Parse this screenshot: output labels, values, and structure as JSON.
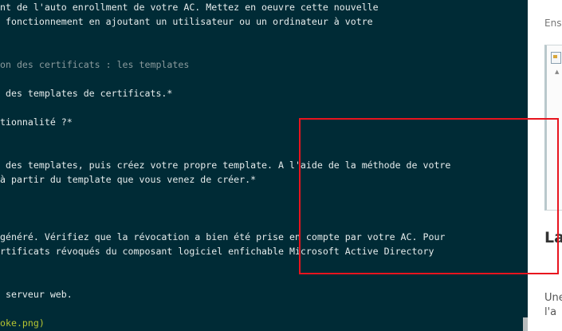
{
  "editor": {
    "lines": [
      "nt de l'auto enrollment de votre AC. Mettez en oeuvre cette nouvelle",
      " fonctionnement en ajoutant un utilisateur ou un ordinateur à votre",
      "on des certificats : les templates",
      " des templates de certificats.*",
      "tionnalité ?*",
      " des templates, puis créez votre propre template. A l'aide de la méthode de votre",
      "à partir du template que vous venez de créer.*",
      "généré. Vérifiez que la révocation a bien été prise en compte par votre AC. Pour",
      "rtificats révoqués du composant logiciel enfichable Microsoft Active Directory",
      " serveur web.",
      "oke.png)"
    ]
  },
  "sidebar": {
    "ens": "Ens",
    "heading": "La",
    "text1": "Une",
    "text2": "l'a"
  },
  "colors": {
    "editor_bg": "#002b36",
    "text": "#e6ecec",
    "dim_text": "#8a9a9c",
    "link_text": "#b5c431",
    "highlight": "#e8141e"
  }
}
